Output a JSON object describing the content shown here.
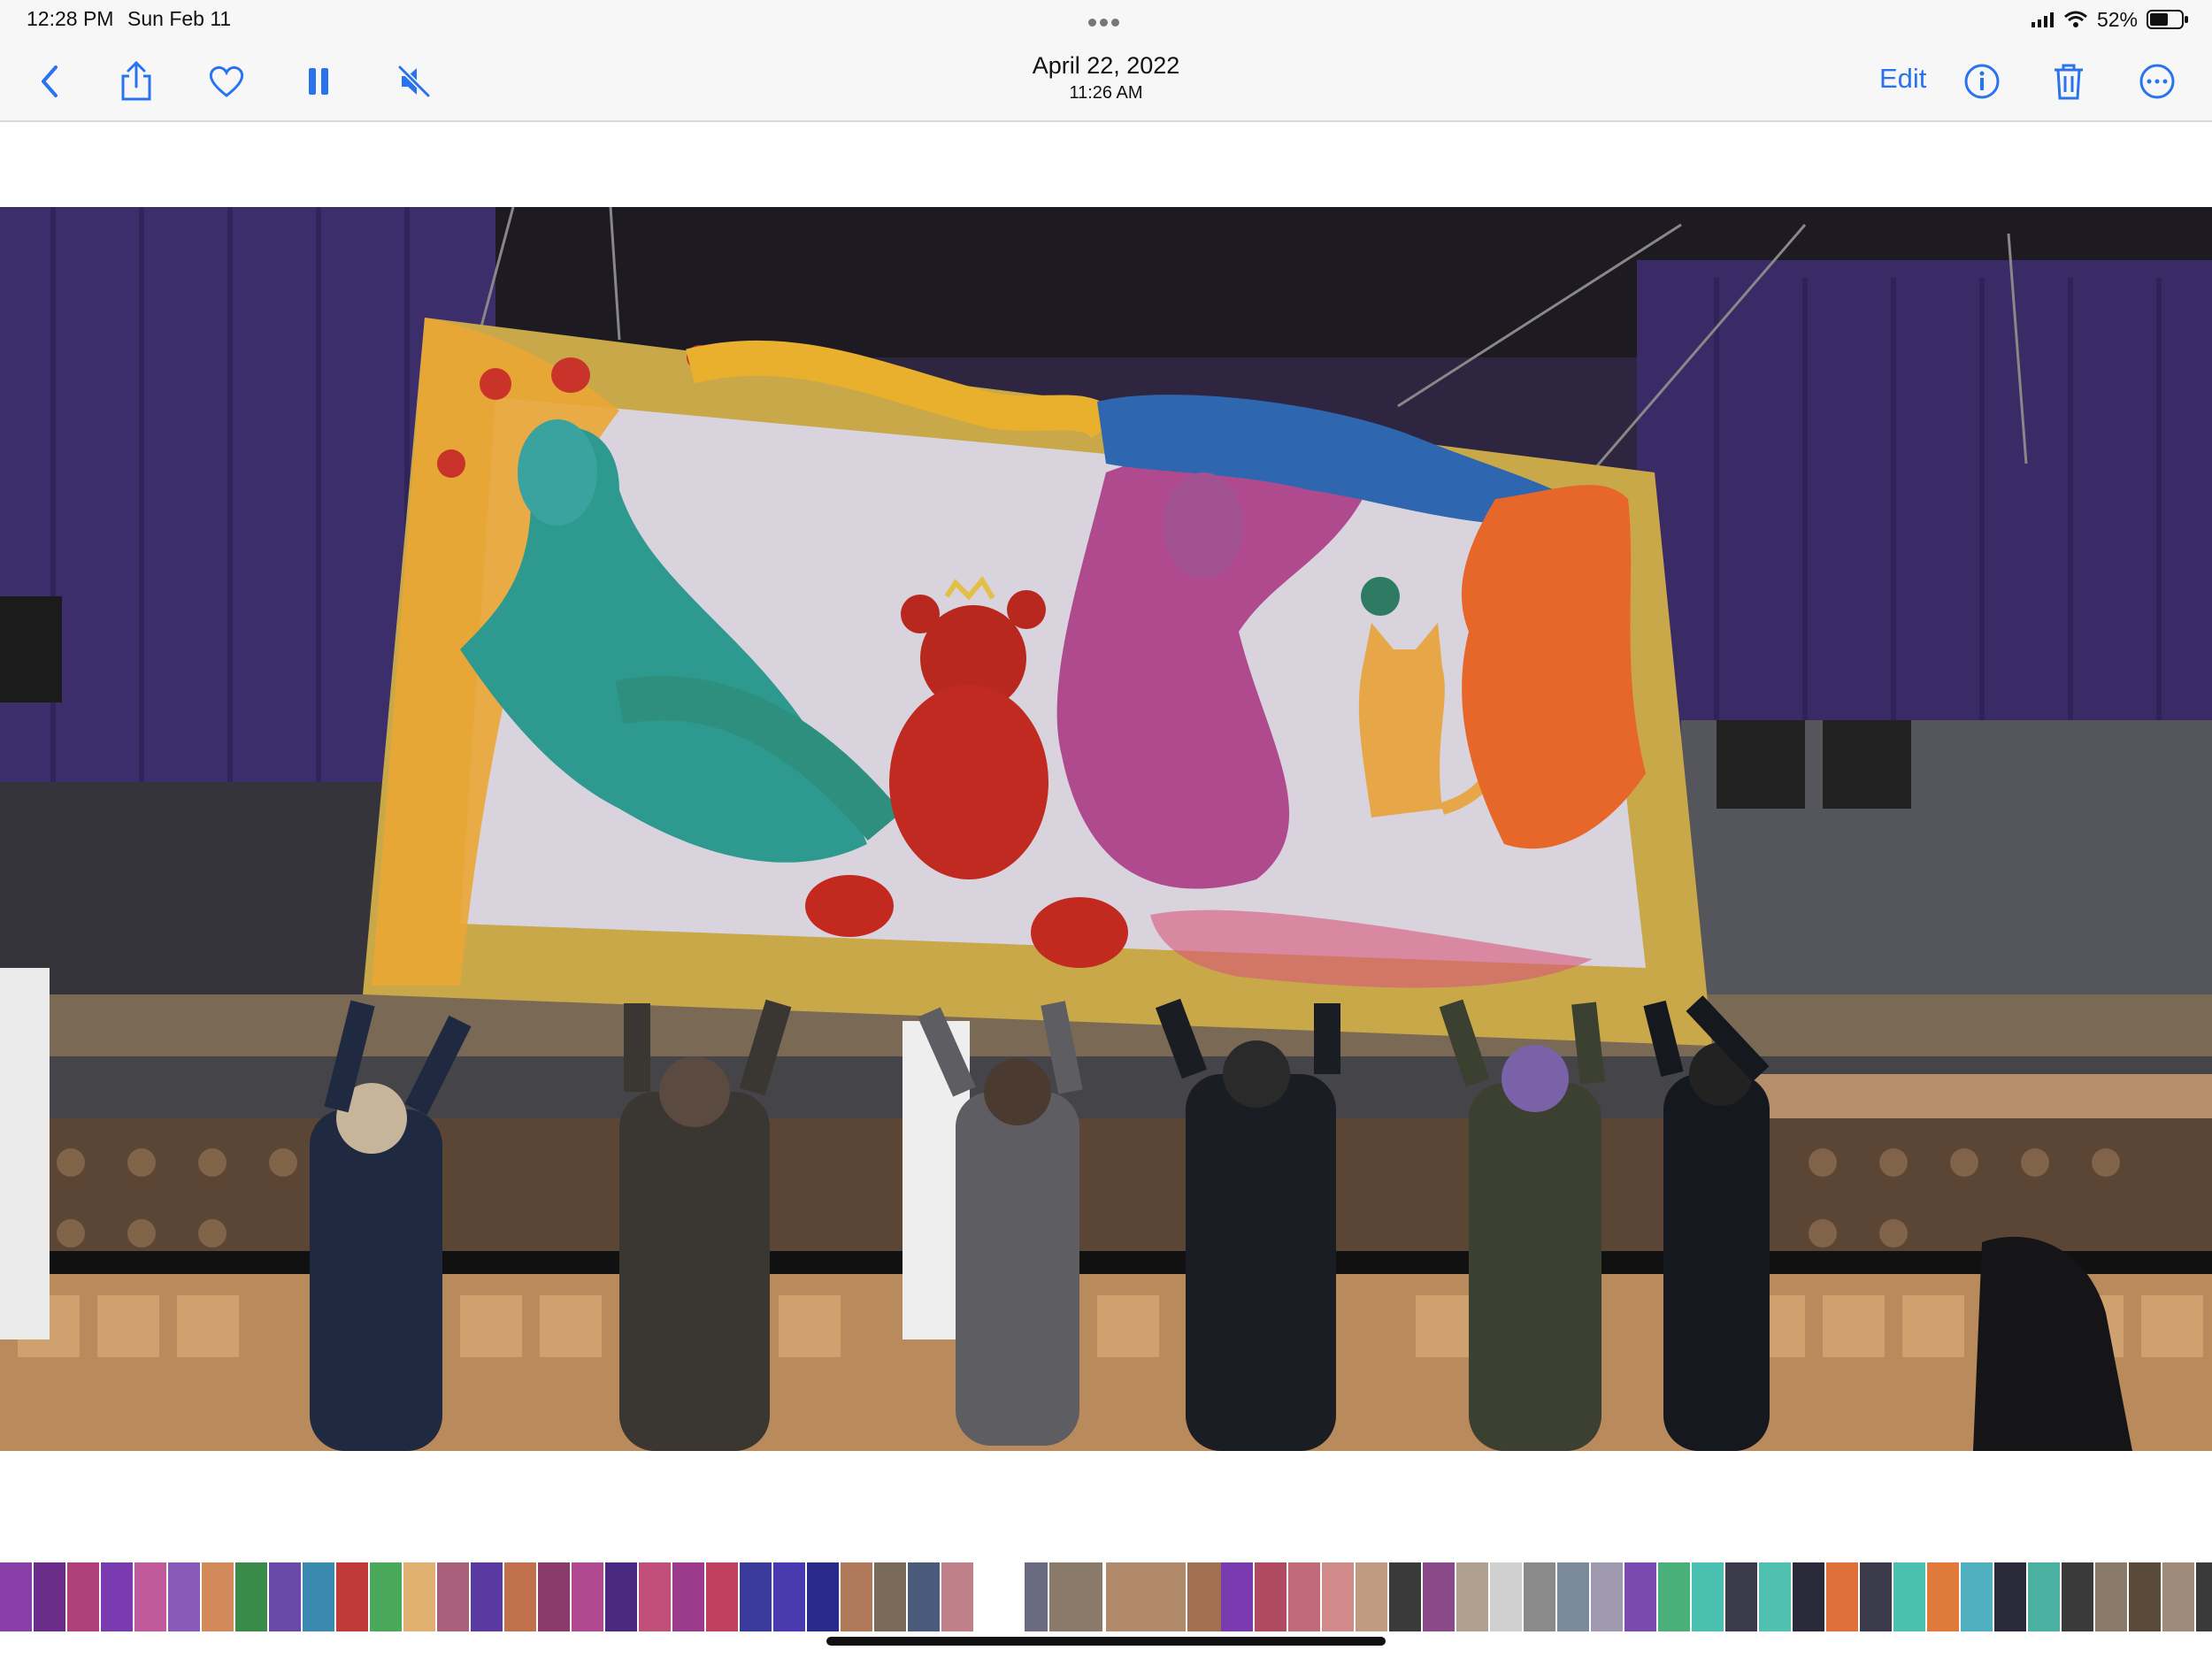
{
  "status_bar": {
    "time": "12:28 PM",
    "date": "Sun Feb 11",
    "battery": "52%"
  },
  "toolbar": {
    "title_date": "April 22, 2022",
    "title_time": "11:26 AM",
    "edit_label": "Edit",
    "icons": [
      "back-icon",
      "share-icon",
      "heart-icon",
      "pause-icon",
      "mute-icon",
      "info-icon",
      "trash-icon",
      "more-icon"
    ]
  },
  "colors": {
    "accent": "#2a73ee",
    "toolbar_bg": "#f7f7f7",
    "curtain": "#3b2a63",
    "mural_frame": "#c9a84a"
  },
  "photo": {
    "subject": "video-frame"
  }
}
